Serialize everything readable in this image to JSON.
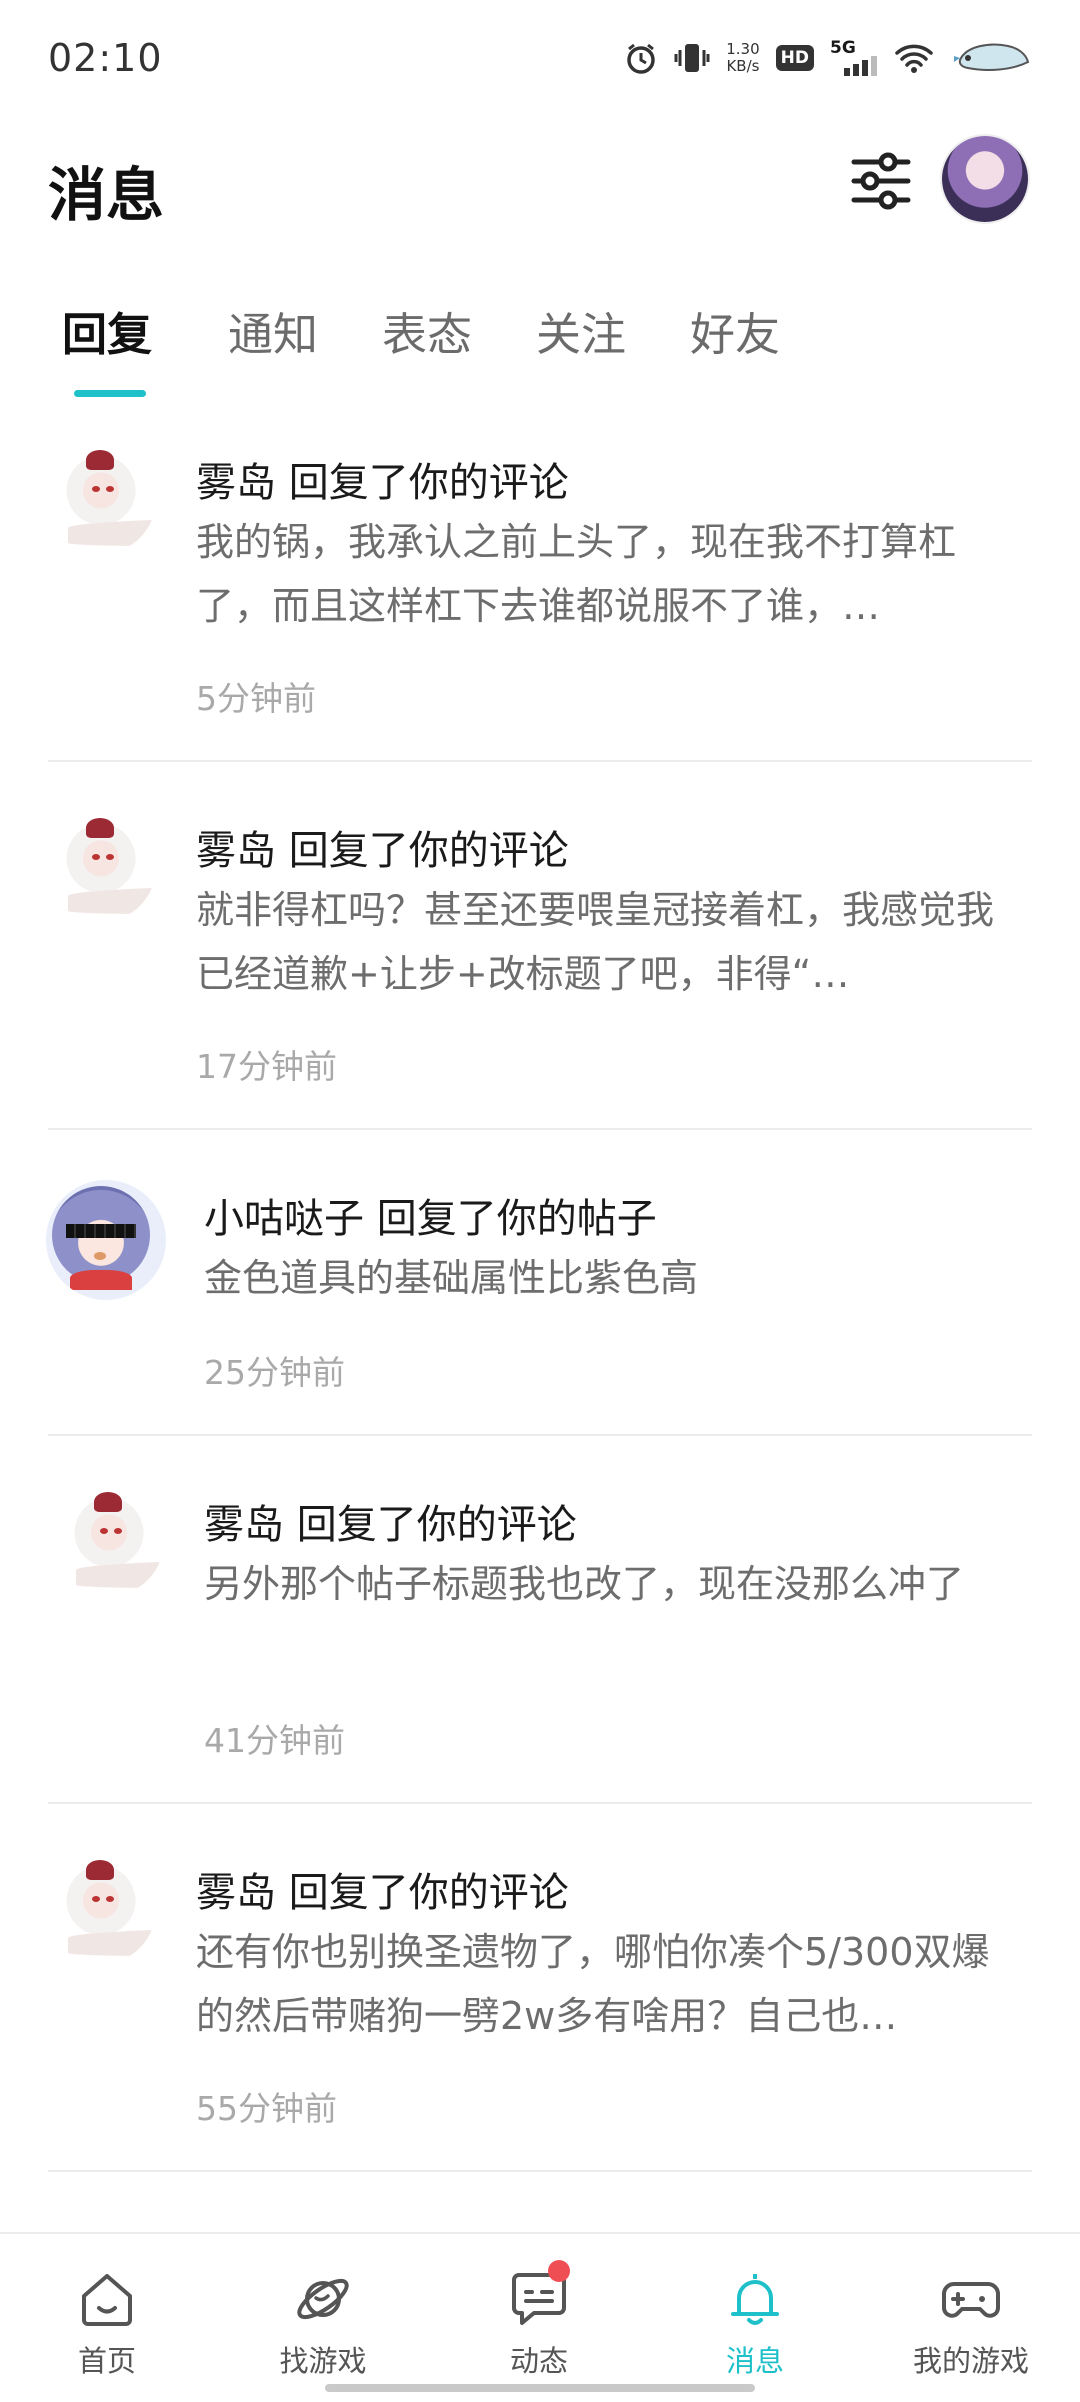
{
  "status_bar": {
    "time": "02:10",
    "net_speed_value": "1.30",
    "net_speed_unit": "KB/s",
    "hd_label": "HD",
    "network_label": "5G"
  },
  "header": {
    "title": "消息"
  },
  "tabs": [
    {
      "label": "回复",
      "active": true
    },
    {
      "label": "通知",
      "active": false
    },
    {
      "label": "表态",
      "active": false
    },
    {
      "label": "关注",
      "active": false
    },
    {
      "label": "好友",
      "active": false
    }
  ],
  "messages": [
    {
      "user": "雾岛",
      "action": "回复了你的评论",
      "title": "雾岛 回复了你的评论",
      "body": "我的锅，我承认之前上头了，现在我不打算杠了，而且这样杠下去谁都说服不了谁，…",
      "time": "5分钟前"
    },
    {
      "user": "雾岛",
      "action": "回复了你的评论",
      "title": "雾岛 回复了你的评论",
      "body": "就非得杠吗？甚至还要喂皇冠接着杠，我感觉我已经道歉+让步+改标题了吧，非得“…",
      "time": "17分钟前"
    },
    {
      "user": "小咕哒子",
      "action": "回复了你的帖子",
      "title": "小咕哒子 回复了你的帖子",
      "body": "金色道具的基础属性比紫色高",
      "time": "25分钟前"
    },
    {
      "user": "雾岛",
      "action": "回复了你的评论",
      "title": "雾岛 回复了你的评论",
      "body": "另外那个帖子标题我也改了，现在没那么冲了",
      "time": "41分钟前"
    },
    {
      "user": "雾岛",
      "action": "回复了你的评论",
      "title": "雾岛 回复了你的评论",
      "body": "还有你也别换圣遗物了，哪怕你凑个5/300双爆的然后带赌狗一劈2w多有啥用？自己也…",
      "time": "55分钟前"
    }
  ],
  "bottom_nav": [
    {
      "label": "首页",
      "icon": "home-icon"
    },
    {
      "label": "找游戏",
      "icon": "planet-icon"
    },
    {
      "label": "动态",
      "icon": "chat-icon",
      "badge": true
    },
    {
      "label": "消息",
      "icon": "bell-icon",
      "active": true
    },
    {
      "label": "我的游戏",
      "icon": "gamepad-icon"
    }
  ],
  "colors": {
    "accent": "#1ec1c9",
    "badge": "#f04e55",
    "secondary_text": "#6d6d6d",
    "time_text": "#a9a9a9"
  }
}
